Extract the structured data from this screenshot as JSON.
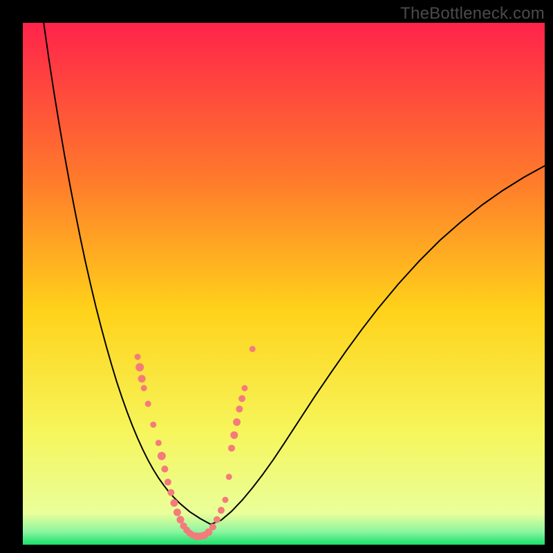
{
  "watermark": "TheBottleneck.com",
  "chart_data": {
    "type": "line",
    "title": "",
    "xlabel": "",
    "ylabel": "",
    "xlim": [
      0,
      100
    ],
    "ylim": [
      0,
      100
    ],
    "grid": false,
    "legend": false,
    "background_gradient": {
      "stops": [
        {
          "offset": 0.0,
          "color": "#ff234b"
        },
        {
          "offset": 0.3,
          "color": "#ff7a2b"
        },
        {
          "offset": 0.55,
          "color": "#ffd21a"
        },
        {
          "offset": 0.78,
          "color": "#f6f55a"
        },
        {
          "offset": 0.94,
          "color": "#eaff9a"
        },
        {
          "offset": 0.975,
          "color": "#8cf5a0"
        },
        {
          "offset": 1.0,
          "color": "#18e06a"
        }
      ]
    },
    "series": [
      {
        "name": "bottleneck-curve",
        "stroke": "#000000",
        "stroke_width": 2,
        "x": [
          4,
          5,
          6,
          7,
          8,
          9,
          10,
          11,
          12,
          13,
          14,
          15,
          16,
          17,
          18,
          19,
          20,
          21,
          22,
          23,
          24,
          25,
          26,
          27,
          28,
          29,
          30,
          32,
          34,
          36,
          38,
          40,
          42,
          44,
          46,
          48,
          50,
          53,
          56,
          59,
          62,
          65,
          68,
          72,
          76,
          80,
          84,
          88,
          92,
          96,
          100
        ],
        "y": [
          100,
          93,
          86.5,
          80.4,
          74.6,
          69.1,
          63.9,
          58.9,
          54.2,
          49.8,
          45.6,
          41.7,
          38,
          34.5,
          31.2,
          28.2,
          25.4,
          22.8,
          20.4,
          18.2,
          16.2,
          14.4,
          12.8,
          11.4,
          10.1,
          9,
          8,
          6.3,
          5,
          3.9,
          4.7,
          6.4,
          8.5,
          10.9,
          13.5,
          16.3,
          19.3,
          23.9,
          28.5,
          32.9,
          37.2,
          41.3,
          45.2,
          50,
          54.4,
          58.4,
          61.9,
          65.1,
          67.9,
          70.4,
          72.6
        ]
      }
    ],
    "scatter": {
      "name": "data-points",
      "fill": "#f47b7b",
      "points": [
        {
          "x": 22.0,
          "y": 36.0,
          "r": 4.5
        },
        {
          "x": 22.4,
          "y": 34.0,
          "r": 6.0
        },
        {
          "x": 22.8,
          "y": 31.8,
          "r": 5.5
        },
        {
          "x": 23.2,
          "y": 30.0,
          "r": 4.5
        },
        {
          "x": 24.0,
          "y": 27.0,
          "r": 4.5
        },
        {
          "x": 25.0,
          "y": 23.0,
          "r": 4.5
        },
        {
          "x": 26.0,
          "y": 19.5,
          "r": 4.5
        },
        {
          "x": 26.6,
          "y": 17.0,
          "r": 6.0
        },
        {
          "x": 27.2,
          "y": 14.5,
          "r": 5.0
        },
        {
          "x": 27.8,
          "y": 12.0,
          "r": 5.0
        },
        {
          "x": 28.4,
          "y": 10.0,
          "r": 5.0
        },
        {
          "x": 29.0,
          "y": 8.0,
          "r": 5.5
        },
        {
          "x": 29.6,
          "y": 6.2,
          "r": 5.5
        },
        {
          "x": 30.2,
          "y": 4.8,
          "r": 5.5
        },
        {
          "x": 30.8,
          "y": 3.6,
          "r": 5.0
        },
        {
          "x": 31.4,
          "y": 2.8,
          "r": 5.0
        },
        {
          "x": 32.0,
          "y": 2.2,
          "r": 5.0
        },
        {
          "x": 32.6,
          "y": 1.8,
          "r": 5.0
        },
        {
          "x": 33.3,
          "y": 1.6,
          "r": 5.5
        },
        {
          "x": 34.0,
          "y": 1.6,
          "r": 5.5
        },
        {
          "x": 34.8,
          "y": 1.8,
          "r": 5.5
        },
        {
          "x": 35.6,
          "y": 2.4,
          "r": 5.5
        },
        {
          "x": 36.4,
          "y": 3.4,
          "r": 5.0
        },
        {
          "x": 37.2,
          "y": 4.8,
          "r": 5.0
        },
        {
          "x": 38.0,
          "y": 6.6,
          "r": 5.0
        },
        {
          "x": 38.8,
          "y": 8.6,
          "r": 4.5
        },
        {
          "x": 39.5,
          "y": 13.0,
          "r": 4.5
        },
        {
          "x": 40.0,
          "y": 18.5,
          "r": 5.0
        },
        {
          "x": 40.5,
          "y": 21.0,
          "r": 5.5
        },
        {
          "x": 41.0,
          "y": 23.5,
          "r": 5.5
        },
        {
          "x": 41.5,
          "y": 26.0,
          "r": 5.0
        },
        {
          "x": 42.0,
          "y": 28.0,
          "r": 5.0
        },
        {
          "x": 42.5,
          "y": 30.0,
          "r": 4.5
        },
        {
          "x": 44.0,
          "y": 37.5,
          "r": 4.5
        }
      ]
    }
  }
}
